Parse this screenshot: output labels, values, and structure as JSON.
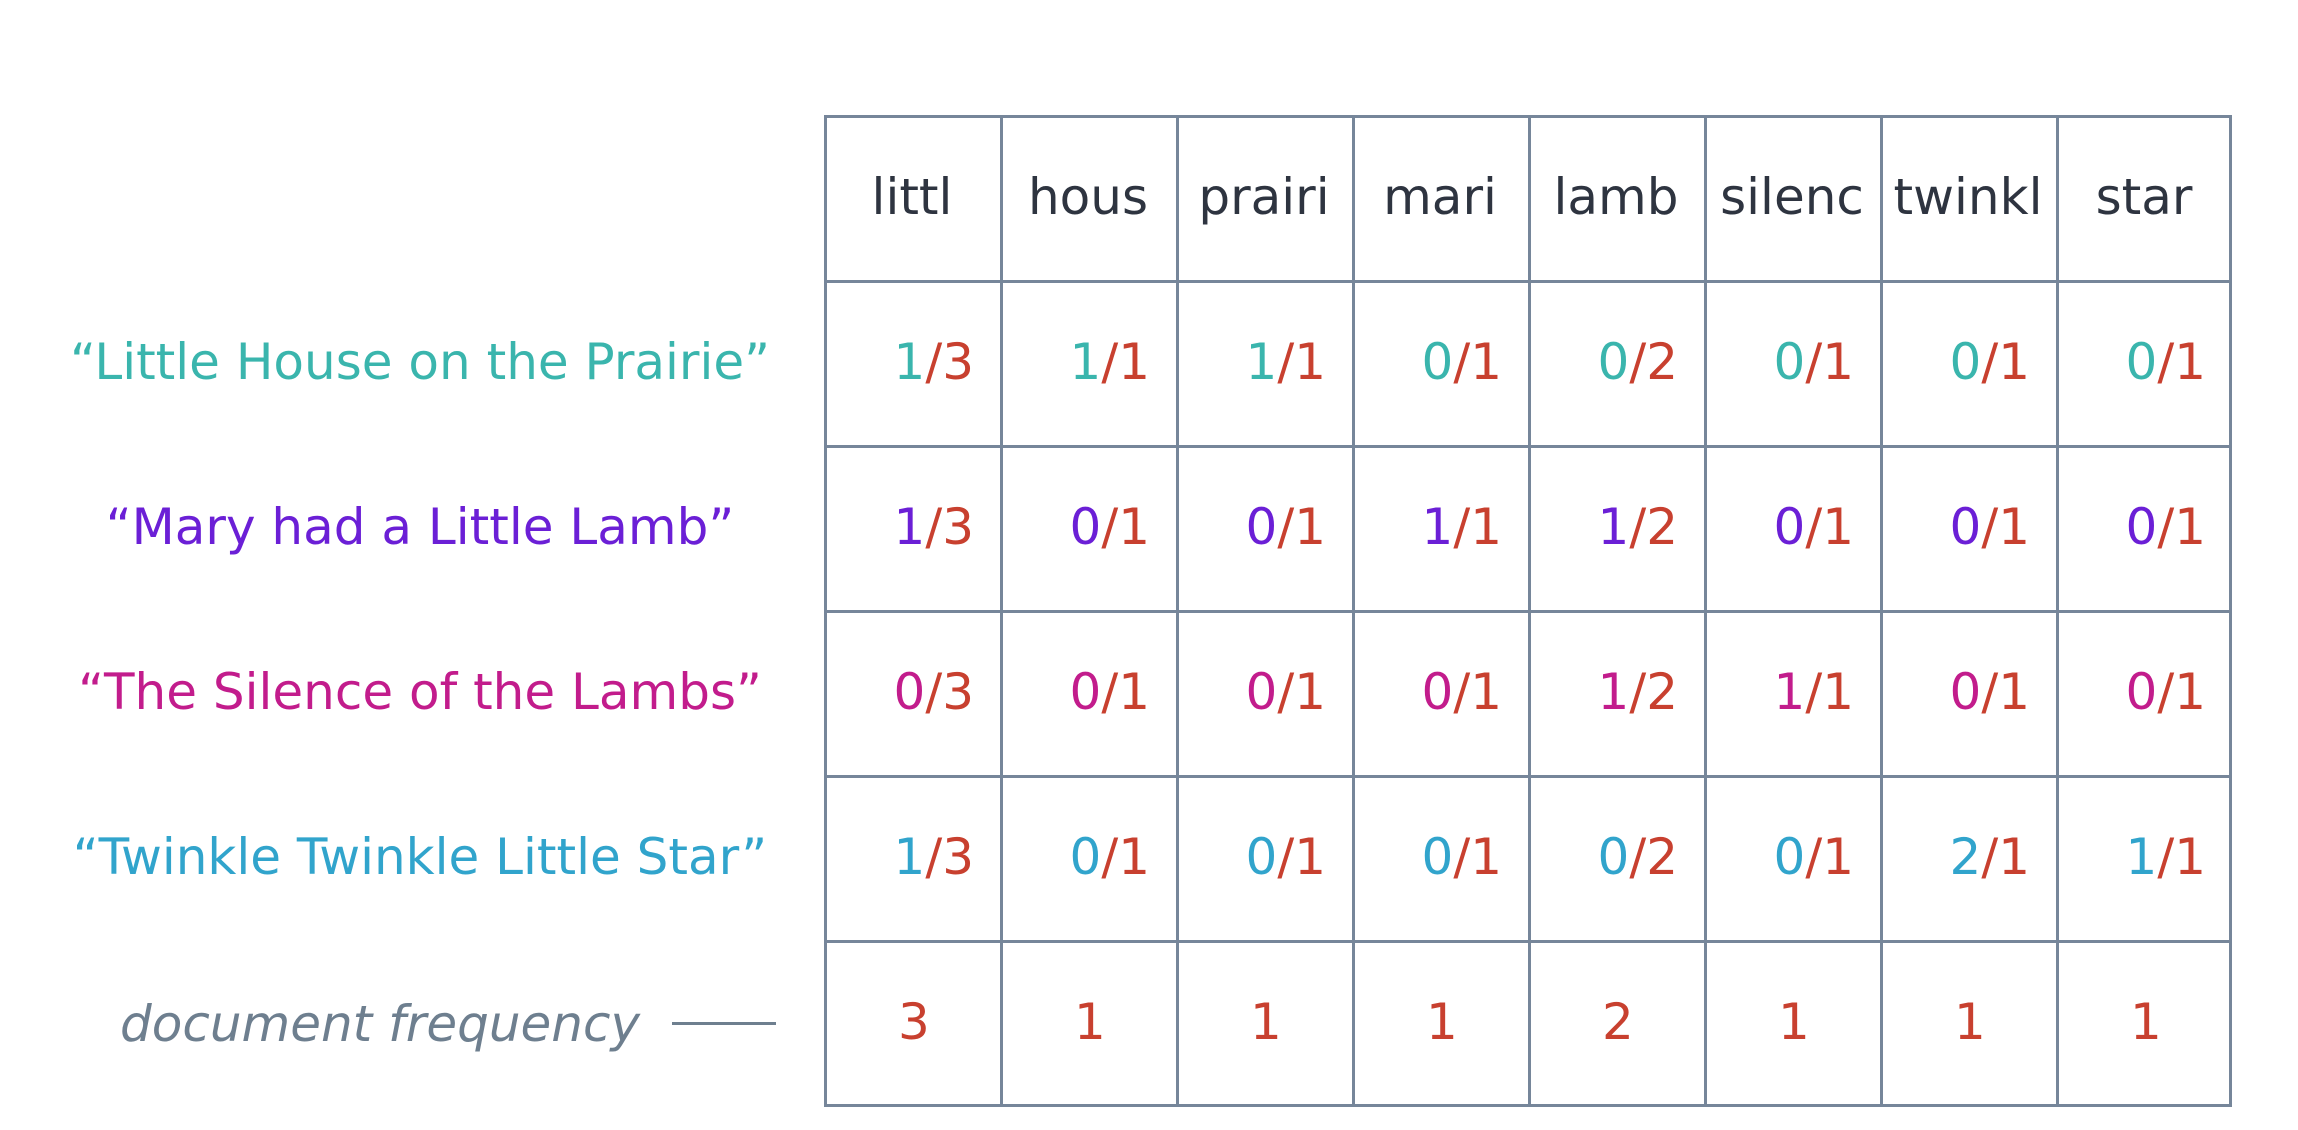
{
  "colors": {
    "denominator": "#c8402f",
    "document_frequency_label": "#6e7f8f",
    "header_text": "#2e3440",
    "grid_lines": "#76869a"
  },
  "terms": [
    "littl",
    "hous",
    "prairi",
    "mari",
    "lamb",
    "silenc",
    "twinkl",
    "star"
  ],
  "documents": [
    {
      "title": "“Little House on the Prairie”",
      "color": "#3ab5ad",
      "cells": [
        {
          "num": "1",
          "den": "3"
        },
        {
          "num": "1",
          "den": "1"
        },
        {
          "num": "1",
          "den": "1"
        },
        {
          "num": "0",
          "den": "1"
        },
        {
          "num": "0",
          "den": "2"
        },
        {
          "num": "0",
          "den": "1"
        },
        {
          "num": "0",
          "den": "1"
        },
        {
          "num": "0",
          "den": "1"
        }
      ]
    },
    {
      "title": "“Mary had a Little Lamb”",
      "color": "#6b1fd6",
      "cells": [
        {
          "num": "1",
          "den": "3"
        },
        {
          "num": "0",
          "den": "1"
        },
        {
          "num": "0",
          "den": "1"
        },
        {
          "num": "1",
          "den": "1"
        },
        {
          "num": "1",
          "den": "2"
        },
        {
          "num": "0",
          "den": "1"
        },
        {
          "num": "0",
          "den": "1"
        },
        {
          "num": "0",
          "den": "1"
        }
      ]
    },
    {
      "title": "“The Silence of the Lambs”",
      "color": "#c21c8c",
      "cells": [
        {
          "num": "0",
          "den": "3"
        },
        {
          "num": "0",
          "den": "1"
        },
        {
          "num": "0",
          "den": "1"
        },
        {
          "num": "0",
          "den": "1"
        },
        {
          "num": "1",
          "den": "2"
        },
        {
          "num": "1",
          "den": "1"
        },
        {
          "num": "0",
          "den": "1"
        },
        {
          "num": "0",
          "den": "1"
        }
      ]
    },
    {
      "title": "“Twinkle Twinkle Little Star”",
      "color": "#31a4cc",
      "cells": [
        {
          "num": "1",
          "den": "3"
        },
        {
          "num": "0",
          "den": "1"
        },
        {
          "num": "0",
          "den": "1"
        },
        {
          "num": "0",
          "den": "1"
        },
        {
          "num": "0",
          "den": "2"
        },
        {
          "num": "0",
          "den": "1"
        },
        {
          "num": "2",
          "den": "1"
        },
        {
          "num": "1",
          "den": "1"
        }
      ]
    }
  ],
  "document_frequency": {
    "label": "document frequency",
    "values": [
      "3",
      "1",
      "1",
      "1",
      "2",
      "1",
      "1",
      "1"
    ]
  }
}
